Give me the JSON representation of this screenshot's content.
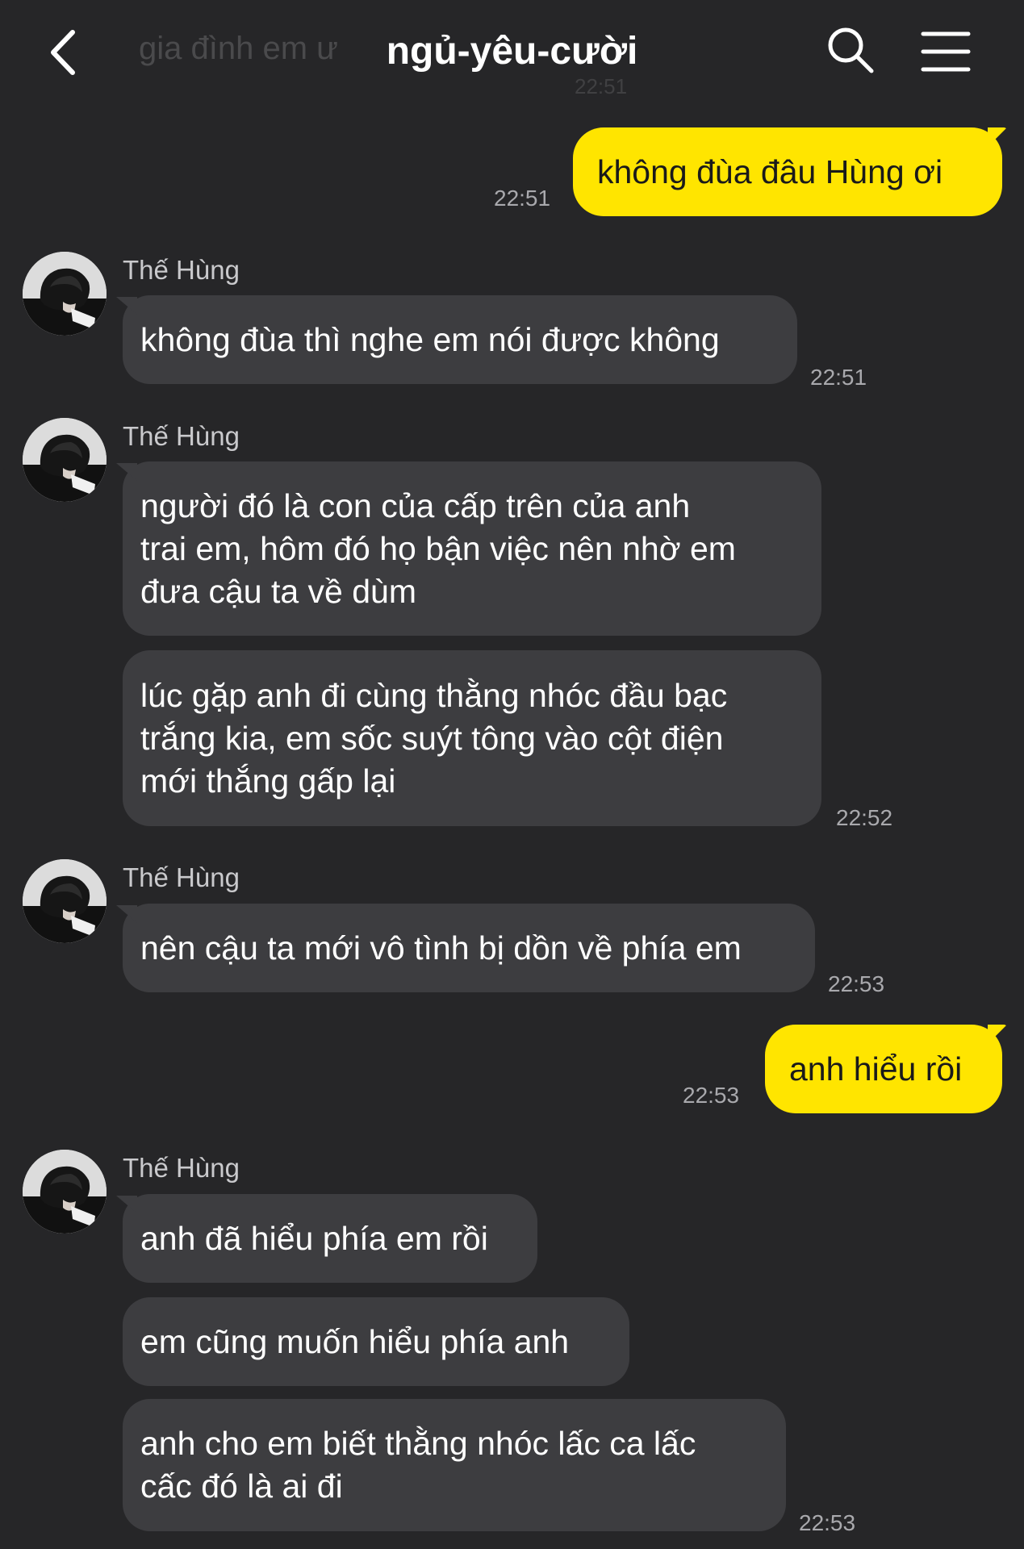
{
  "header": {
    "title": "ngủ-yêu-cười",
    "ghost_preview": "gia đình em ư",
    "ghost_time": "22:51"
  },
  "messages": [
    {
      "id": "m1",
      "type": "out",
      "text": "không đùa đâu Hùng ơi",
      "time": "22:51"
    },
    {
      "id": "m2",
      "type": "in",
      "sender": "Thế Hùng",
      "text": "không đùa thì nghe em nói được không",
      "time": "22:51"
    },
    {
      "id": "m3",
      "type": "in",
      "sender": "Thế Hùng",
      "text": "người đó là con của cấp trên của anh\ntrai em, hôm đó họ bận việc nên nhờ em\nđưa cậu ta về dùm"
    },
    {
      "id": "m4",
      "type": "in",
      "text": "lúc gặp anh đi cùng thằng nhóc đầu bạc\ntrắng kia, em sốc suýt tông vào cột điện\nmới thắng gấp lại",
      "time": "22:52"
    },
    {
      "id": "m5",
      "type": "in",
      "sender": "Thế Hùng",
      "text": "nên cậu ta mới vô tình bị dồn về phía em",
      "time": "22:53"
    },
    {
      "id": "m6",
      "type": "out",
      "text": "anh hiểu rồi",
      "time": "22:53"
    },
    {
      "id": "m7",
      "type": "in",
      "sender": "Thế Hùng",
      "text": "anh đã hiểu phía em rồi"
    },
    {
      "id": "m8",
      "type": "in",
      "text": "em cũng muốn hiểu phía anh"
    },
    {
      "id": "m9",
      "type": "in",
      "text": "anh cho em biết thằng nhóc lấc ca lấc\ncấc đó là ai đi",
      "time": "22:53"
    }
  ],
  "colors": {
    "background": "#262628",
    "incoming_bubble": "#3d3d40",
    "outgoing_bubble": "#ffe500",
    "timestamp": "#a9a9ad"
  },
  "icons": [
    "chevron-left-icon",
    "search-icon",
    "menu-icon",
    "avatar"
  ]
}
